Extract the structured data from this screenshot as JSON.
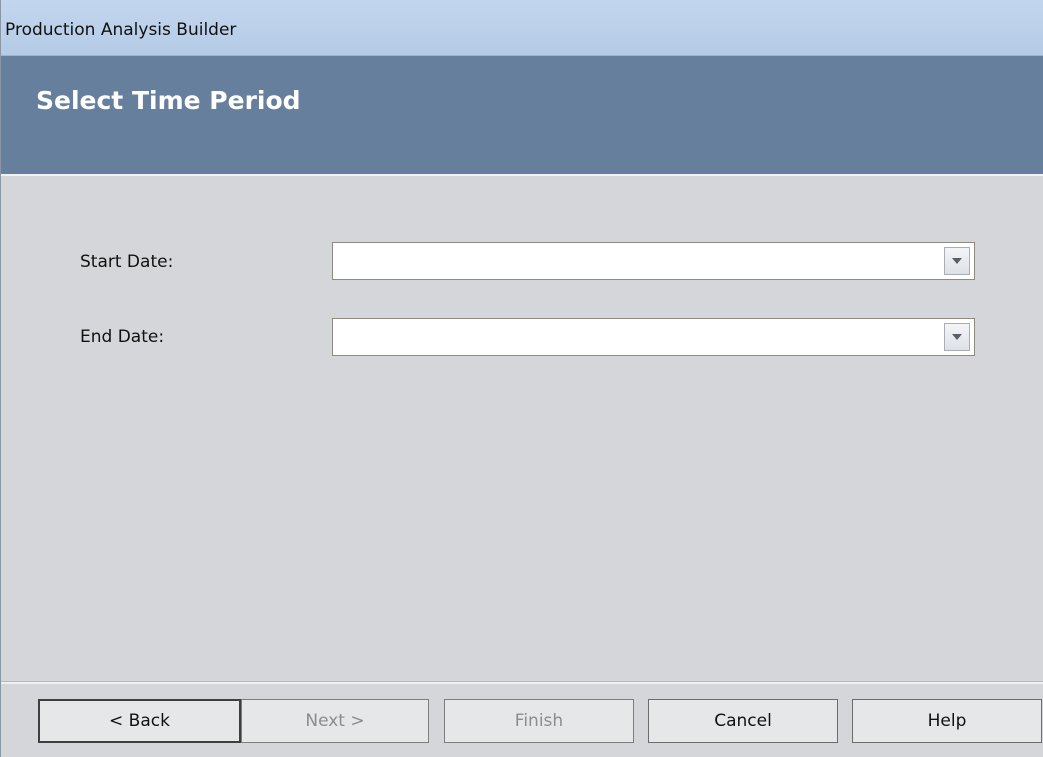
{
  "window": {
    "title": "Production Analysis Builder"
  },
  "header": {
    "heading": "Select Time Period"
  },
  "form": {
    "start_date": {
      "label": "Start Date:",
      "value": ""
    },
    "end_date": {
      "label": "End Date:",
      "value": ""
    }
  },
  "buttons": {
    "back": "< Back",
    "next": "Next >",
    "finish": "Finish",
    "cancel": "Cancel",
    "help": "Help"
  },
  "icons": {
    "dropdown": "chevron-down-icon"
  },
  "colors": {
    "header_band": "#667f9c",
    "titlebar": "#c3d6ee",
    "background": "#d4d6d9"
  }
}
